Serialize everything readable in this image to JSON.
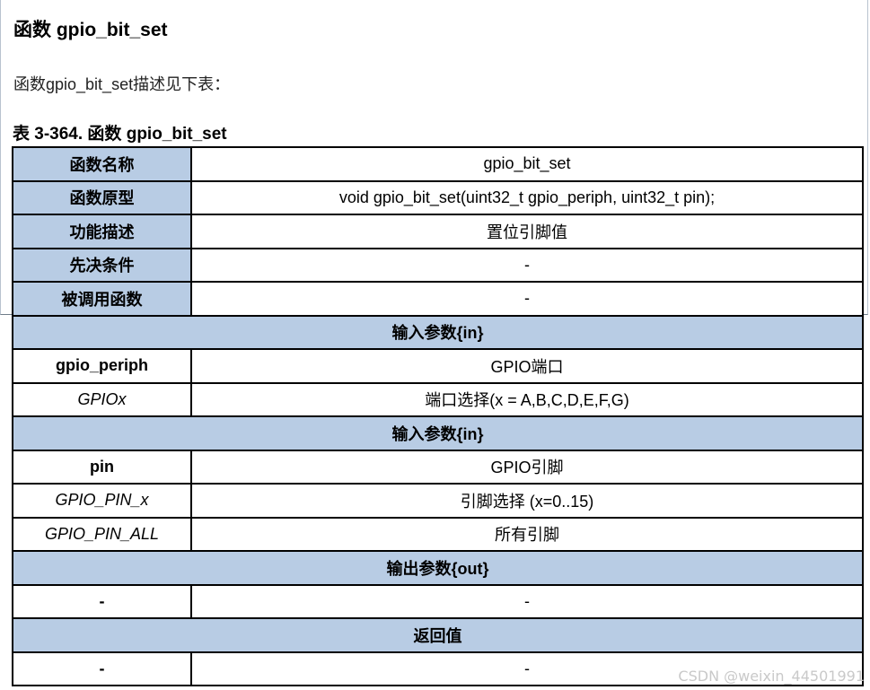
{
  "heading": "函数 gpio_bit_set",
  "intro": "函数gpio_bit_set描述见下表：",
  "caption": "表 3-364.  函数 gpio_bit_set",
  "info_rows": [
    {
      "label": "函数名称",
      "value": "gpio_bit_set"
    },
    {
      "label": "函数原型",
      "value": "void gpio_bit_set(uint32_t gpio_periph, uint32_t pin);"
    },
    {
      "label": "功能描述",
      "value": "置位引脚值"
    },
    {
      "label": "先决条件",
      "value": "-"
    },
    {
      "label": "被调用函数",
      "value": "-"
    }
  ],
  "sections": {
    "input1": {
      "title": "输入参数{in}",
      "rows": [
        {
          "name": "gpio_periph",
          "desc": "GPIO端口"
        },
        {
          "name": "GPIOx",
          "desc": "端口选择(x = A,B,C,D,E,F,G)"
        }
      ]
    },
    "input2": {
      "title": "输入参数{in}",
      "rows": [
        {
          "name": "pin",
          "desc": "GPIO引脚"
        },
        {
          "name": "GPIO_PIN_x",
          "desc": "引脚选择  (x=0..15)"
        },
        {
          "name": "GPIO_PIN_ALL",
          "desc": "所有引脚"
        }
      ]
    },
    "output": {
      "title": "输出参数{out}",
      "rows": [
        {
          "name": "-",
          "desc": "-"
        }
      ]
    },
    "return": {
      "title": "返回值",
      "rows": [
        {
          "name": "-",
          "desc": "-"
        }
      ]
    }
  },
  "watermark": "CSDN @weixin_44501991",
  "colors": {
    "header_fill": "#b8cce4",
    "border": "#000000"
  }
}
